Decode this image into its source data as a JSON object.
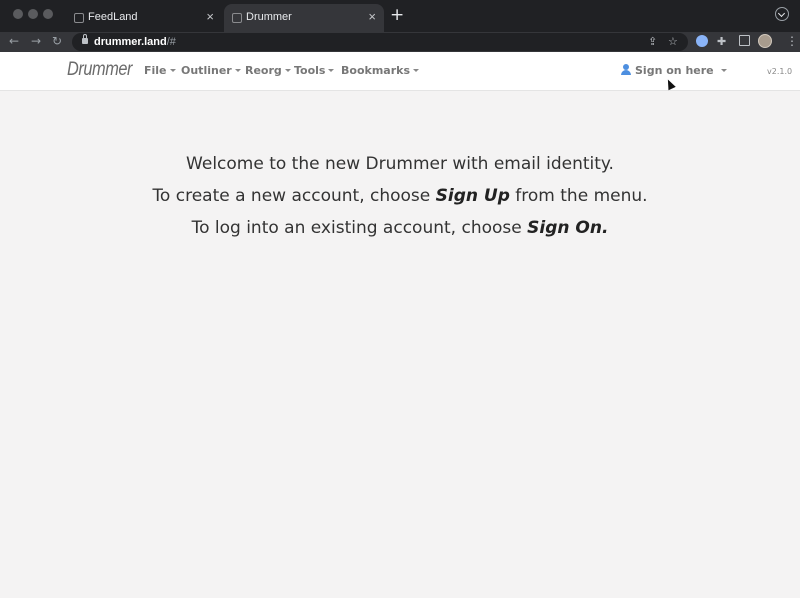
{
  "browser": {
    "tabs": [
      {
        "title": "FeedLand",
        "active": false
      },
      {
        "title": "Drummer",
        "active": true
      }
    ],
    "new_tab_symbol": "+",
    "close_symbol": "×",
    "url_host": "drummer.land",
    "url_rest": "/#"
  },
  "app": {
    "brand": "Drummer",
    "menus": [
      "File",
      "Outliner",
      "Reorg",
      "Tools",
      "Bookmarks"
    ],
    "sign_on_label": "Sign on here",
    "version": "v2.1.0"
  },
  "welcome": {
    "line1": "Welcome to the new Drummer with email identity.",
    "line2_before": "To create a new account, choose ",
    "line2_em": "Sign Up",
    "line2_after": " from the menu.",
    "line3_before": "To log into an existing account, choose ",
    "line3_em": "Sign On."
  },
  "icons": [
    "back-icon",
    "forward-icon",
    "reload-icon",
    "lock-icon",
    "share-icon",
    "star-icon",
    "extension-icon",
    "puzzle-icon",
    "sidebar-icon",
    "avatar",
    "kebab-menu-icon",
    "user-icon",
    "mouse-cursor-icon"
  ]
}
